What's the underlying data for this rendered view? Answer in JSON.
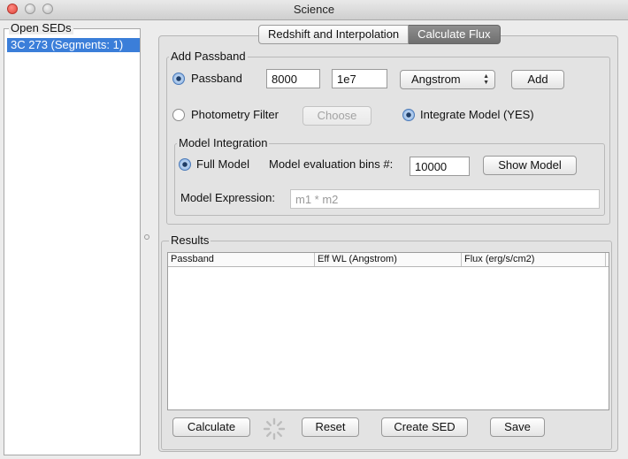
{
  "window": {
    "title": "Science"
  },
  "left_panel": {
    "title": "Open SEDs",
    "items": [
      "3C 273 (Segments: 1)"
    ]
  },
  "tabs": [
    {
      "label": "Redshift and Interpolation",
      "active": false
    },
    {
      "label": "Calculate Flux",
      "active": true
    }
  ],
  "passband": {
    "group_title": "Add Passband",
    "passband_label": "Passband",
    "min_value": "8000",
    "max_value": "1e7",
    "unit_selected": "Angstrom",
    "add_label": "Add",
    "photometry_label": "Photometry Filter",
    "choose_label": "Choose",
    "integrate_label": "Integrate Model (YES)"
  },
  "model_integration": {
    "group_title": "Model Integration",
    "full_model_label": "Full Model",
    "bins_label": "Model evaluation bins #:",
    "bins_value": "10000",
    "show_model_label": "Show Model",
    "expression_label": "Model Expression:",
    "expression_placeholder": "m1 * m2"
  },
  "results": {
    "group_title": "Results",
    "columns": [
      "Passband",
      "Eff WL (Angstrom)",
      "Flux (erg/s/cm2)"
    ]
  },
  "actions": {
    "calculate": "Calculate",
    "reset": "Reset",
    "create_sed": "Create SED",
    "save": "Save"
  },
  "colors": {
    "selection": "#3b7ed9",
    "active_tab": "#7f7f7f"
  }
}
